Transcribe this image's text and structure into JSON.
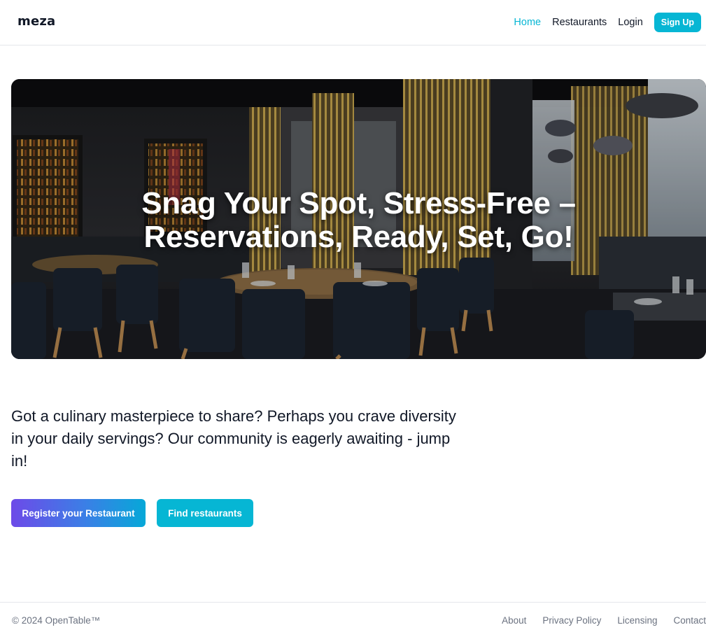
{
  "header": {
    "brand": "meza",
    "nav": [
      {
        "label": "Home"
      },
      {
        "label": "Restaurants"
      },
      {
        "label": "Login"
      }
    ],
    "signup_label": "Sign Up"
  },
  "hero": {
    "title_line1": "Snag Your Spot, Stress-Free –",
    "title_line2": "Reservations, Ready, Set, Go!",
    "image": "restaurant-interior-photo"
  },
  "intro": {
    "text": "Got a culinary masterpiece to share? Perhaps you crave diversity in your daily servings? Our community is eagerly awaiting - jump in!"
  },
  "actions": {
    "register_label": "Register your Restaurant",
    "find_label": "Find restaurants"
  },
  "footer": {
    "copyright": "© 2024 OpenTable™",
    "links": [
      {
        "label": "About"
      },
      {
        "label": "Privacy Policy"
      },
      {
        "label": "Licensing"
      },
      {
        "label": "Contact"
      }
    ]
  },
  "colors": {
    "accent": "#06b6d4",
    "text": "#111827",
    "muted": "#6b7280",
    "border": "#e5e7eb"
  }
}
